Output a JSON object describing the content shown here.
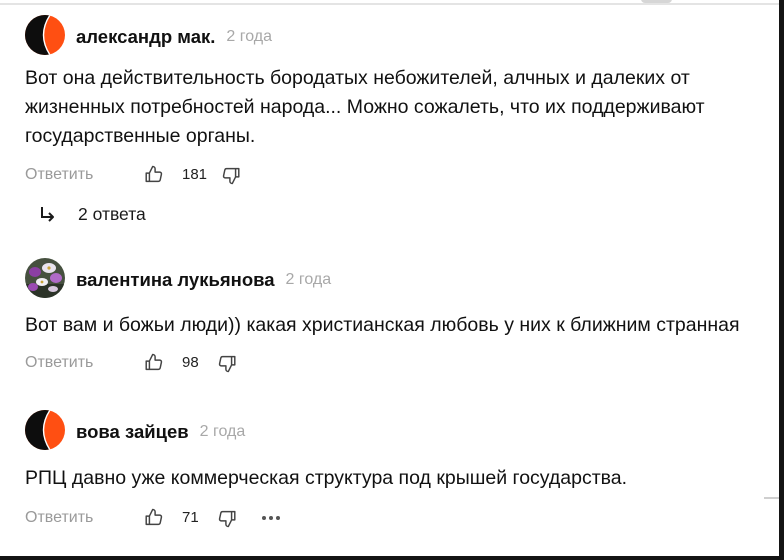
{
  "colors": {
    "text": "#111111",
    "muted": "#9a9a9a",
    "avatar_orange": "#ff4f12",
    "avatar_black": "#0d0d0d",
    "icon": "#444444"
  },
  "icons": {
    "like": "thumbs-up-icon",
    "dislike": "thumbs-down-icon",
    "replies": "reply-arrow-icon",
    "more": "more-dots-icon"
  },
  "comments": [
    {
      "author": "александр мак.",
      "age": "2 года",
      "avatar": "default-avatar",
      "lines": [
        "Вот она действительность бородатых небожителей, алчных и далеких от",
        "жизненных потребностей народа... Можно сожалеть, что их поддерживают",
        "государственные органы."
      ],
      "reply_label": "Ответить",
      "likes": "181"
    },
    {
      "author": "валентина лукьянова",
      "age": "2 года",
      "avatar": "photo-avatar-flowers",
      "lines": [
        "Вот вам и божьи люди)) какая христианская любовь у них к ближним странная"
      ],
      "reply_label": "Ответить",
      "likes": "98"
    },
    {
      "author": "вова зайцев",
      "age": "2 года",
      "avatar": "default-avatar",
      "lines": [
        "РПЦ давно уже коммерческая структура под крышей государства."
      ],
      "reply_label": "Ответить",
      "likes": "71"
    }
  ],
  "replies": {
    "label": "2 ответа"
  }
}
